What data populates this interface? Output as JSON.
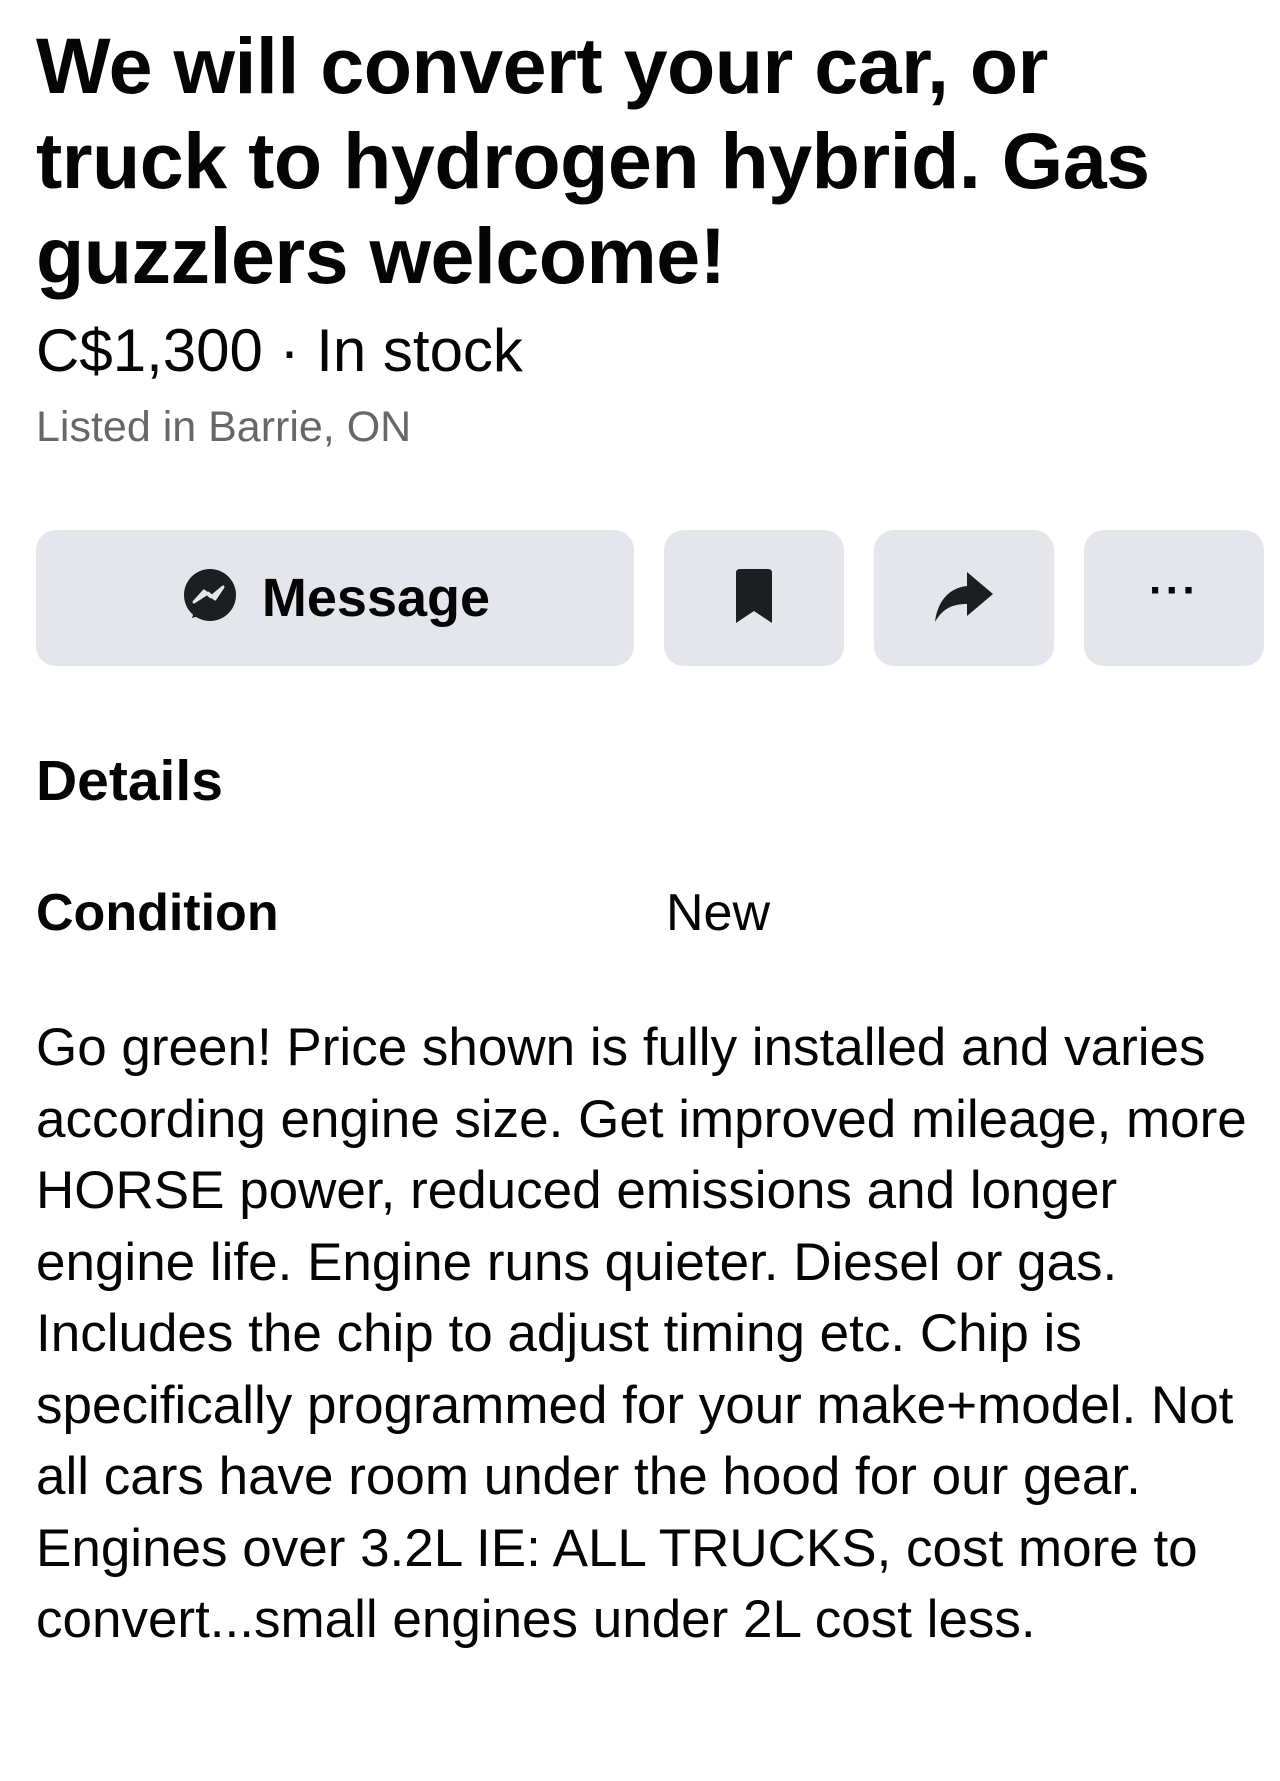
{
  "listing": {
    "title": "We will convert your car, or truck to hydrogen hybrid. Gas guzzlers welcome!",
    "price": "C$1,300",
    "separator": " · ",
    "stock_status": "In stock",
    "location": "Listed in Barrie, ON"
  },
  "actions": {
    "message_label": "Message",
    "more_label": "···",
    "icons": {
      "message": "messenger-icon",
      "save": "bookmark-icon",
      "share": "share-arrow-icon",
      "more": "more-dots-icon"
    }
  },
  "details": {
    "heading": "Details",
    "condition_label": "Condition",
    "condition_value": "New",
    "description": "Go green! Price shown is fully installed and varies according engine size. Get improved mileage, more HORSE power, reduced emissions and longer engine life. Engine runs quieter. Diesel or gas. Includes the chip to adjust timing etc. Chip is specifically programmed for your make+model. Not all cars have room under the hood for our gear. Engines over 3.2L IE: ALL TRUCKS, cost more to convert...small engines under 2L cost less."
  },
  "colors": {
    "text": "#050505",
    "secondary_text": "#65676b",
    "button_bg": "#e4e6eb",
    "icon": "#1c1e21"
  }
}
